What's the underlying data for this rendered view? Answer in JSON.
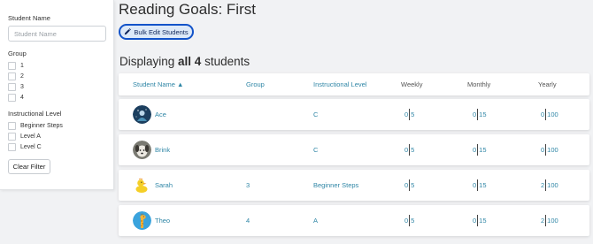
{
  "sidebar": {
    "student_name_label": "Student Name",
    "student_name_placeholder": "Student Name",
    "group_label": "Group",
    "groups": [
      "1",
      "2",
      "3",
      "4"
    ],
    "instructional_level_label": "Instructional Level",
    "levels": [
      "Beginner Steps",
      "Level A",
      "Level C"
    ],
    "clear_filter_label": "Clear Filter"
  },
  "main": {
    "title": "Reading Goals: First",
    "bulk_edit_label": "Bulk Edit Students",
    "displaying_prefix": "Displaying",
    "displaying_count": "all 4",
    "displaying_suffix": "students"
  },
  "table": {
    "headers": {
      "student_name": "Student Name ▲",
      "group": "Group",
      "instructional_level": "Instructional Level",
      "weekly": "Weekly",
      "monthly": "Monthly",
      "yearly": "Yearly"
    },
    "rows": [
      {
        "name": "Ace",
        "group": "",
        "level": "C",
        "weekly_done": "0",
        "weekly_goal": "5",
        "monthly_done": "0",
        "monthly_goal": "15",
        "yearly_done": "0",
        "yearly_goal": "100",
        "avatar": "space-avatar-icon"
      },
      {
        "name": "Brink",
        "group": "",
        "level": "C",
        "weekly_done": "0",
        "weekly_goal": "5",
        "monthly_done": "0",
        "monthly_goal": "15",
        "yearly_done": "0",
        "yearly_goal": "100",
        "avatar": "dog-avatar-icon"
      },
      {
        "name": "Sarah",
        "group": "3",
        "level": "Beginner Steps",
        "weekly_done": "0",
        "weekly_goal": "5",
        "monthly_done": "0",
        "monthly_goal": "15",
        "yearly_done": "2",
        "yearly_goal": "100",
        "avatar": "duck-avatar-icon"
      },
      {
        "name": "Theo",
        "group": "4",
        "level": "A",
        "weekly_done": "0",
        "weekly_goal": "5",
        "monthly_done": "0",
        "monthly_goal": "15",
        "yearly_done": "2",
        "yearly_goal": "100",
        "avatar": "giraffe-avatar-icon"
      }
    ]
  },
  "colors": {
    "link": "#2f86a6",
    "bulk_button_border": "#1253c9",
    "bulk_button_bg": "#dde9f8"
  }
}
